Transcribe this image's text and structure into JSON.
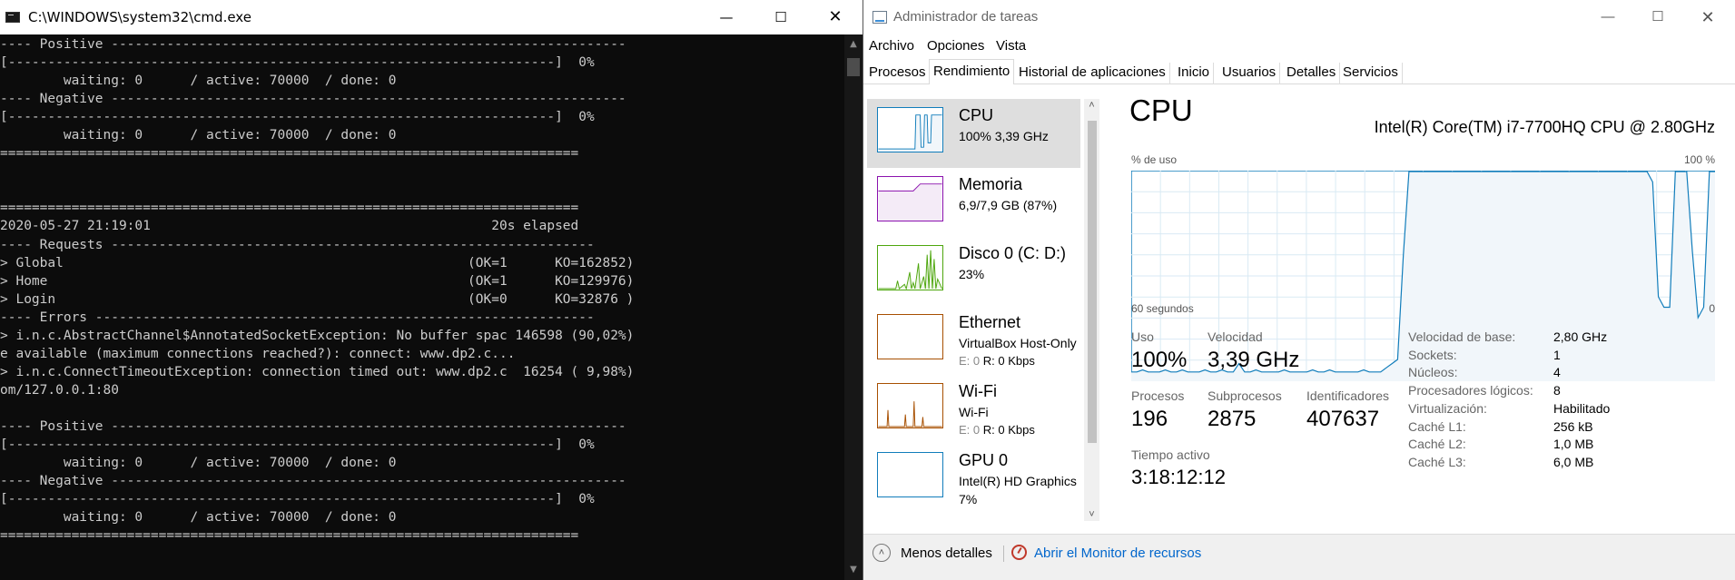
{
  "cmd": {
    "title": "C:\\WINDOWS\\system32\\cmd.exe",
    "lines": [
      "---- Positive -----------------------------------------------------------------",
      "[---------------------------------------------------------------------]  0%",
      "        waiting: 0      / active: 70000  / done: 0",
      "---- Negative -----------------------------------------------------------------",
      "[---------------------------------------------------------------------]  0%",
      "        waiting: 0      / active: 70000  / done: 0",
      "=========================================================================",
      "",
      "",
      "=========================================================================",
      "2020-05-27 21:19:01                                           20s elapsed",
      "---- Requests -------------------------------------------------------------",
      "> Global                                                   (OK=1      KO=162852)",
      "> Home                                                     (OK=1      KO=129976)",
      "> Login                                                    (OK=0      KO=32876 )",
      "---- Errors ---------------------------------------------------------------",
      "> i.n.c.AbstractChannel$AnnotatedSocketException: No buffer spac 146598 (90,02%)",
      "e available (maximum connections reached?): connect: www.dp2.c...",
      "> i.n.c.ConnectTimeoutException: connection timed out: www.dp2.c  16254 ( 9,98%)",
      "om/127.0.0.1:80",
      "",
      "---- Positive -----------------------------------------------------------------",
      "[---------------------------------------------------------------------]  0%",
      "        waiting: 0      / active: 70000  / done: 0",
      "---- Negative -----------------------------------------------------------------",
      "[---------------------------------------------------------------------]  0%",
      "        waiting: 0      / active: 70000  / done: 0",
      "========================================================================="
    ]
  },
  "taskmgr": {
    "title": "Administrador de tareas",
    "menu": [
      "Archivo",
      "Opciones",
      "Vista"
    ],
    "tabs": [
      "Procesos",
      "Rendimiento",
      "Historial de aplicaciones",
      "Inicio",
      "Usuarios",
      "Detalles",
      "Servicios"
    ],
    "active_tab": "Rendimiento",
    "sidebar": [
      {
        "title": "CPU",
        "sub": "100%  3,39 GHz",
        "color": "#117dbb"
      },
      {
        "title": "Memoria",
        "sub": "6,9/7,9 GB (87%)",
        "color": "#8b12ae"
      },
      {
        "title": "Disco 0 (C: D:)",
        "sub": "23%",
        "color": "#4da60c"
      },
      {
        "title": "Ethernet",
        "sub": "VirtualBox Host-Only",
        "sub2_e": "E: 0",
        "sub2_r": "R: 0 Kbps",
        "color": "#a74f01"
      },
      {
        "title": "Wi-Fi",
        "sub": "Wi-Fi",
        "sub2_e": "E: 0",
        "sub2_r": "R: 0 Kbps",
        "color": "#a74f01"
      },
      {
        "title": "GPU 0",
        "sub": "Intel(R) HD Graphics",
        "sub2": "7%",
        "color": "#117dbb"
      }
    ],
    "main": {
      "title": "CPU",
      "cpu_name": "Intel(R) Core(TM) i7-7700HQ CPU @ 2.80GHz",
      "graph_top_left": "% de uso",
      "graph_top_right": "100 %",
      "graph_bottom_left": "60 segundos",
      "graph_bottom_right": "0",
      "stats": {
        "uso_label": "Uso",
        "uso": "100%",
        "velocidad_label": "Velocidad",
        "velocidad": "3,39 GHz",
        "procesos_label": "Procesos",
        "procesos": "196",
        "subprocesos_label": "Subprocesos",
        "subprocesos": "2875",
        "identificadores_label": "Identificadores",
        "identificadores": "407637",
        "tiempo_label": "Tiempo activo",
        "tiempo": "3:18:12:12"
      },
      "specs": [
        {
          "k": "Velocidad de base:",
          "v": "2,80 GHz"
        },
        {
          "k": "Sockets:",
          "v": "1"
        },
        {
          "k": "Núcleos:",
          "v": "4"
        },
        {
          "k": "Procesadores lógicos:",
          "v": "8"
        },
        {
          "k": "Virtualización:",
          "v": "Habilitado"
        },
        {
          "k": "Caché L1:",
          "v": "256 kB"
        },
        {
          "k": "Caché L2:",
          "v": "1,0 MB"
        },
        {
          "k": "Caché L3:",
          "v": "6,0 MB"
        }
      ]
    },
    "cpu_history_percent": [
      4,
      4,
      5,
      4,
      4,
      4,
      5,
      4,
      4,
      5,
      4,
      4,
      4,
      5,
      4,
      4,
      5,
      4,
      4,
      8,
      4,
      4,
      5,
      4,
      4,
      4,
      4,
      5,
      4,
      4,
      4,
      4,
      5,
      4,
      4,
      5,
      4,
      4,
      4,
      4,
      4,
      5,
      4,
      4,
      4,
      6,
      8,
      10,
      60,
      100,
      100,
      100,
      100,
      100,
      100,
      100,
      100,
      100,
      100,
      100,
      100,
      100,
      100,
      100,
      100,
      100,
      100,
      100,
      100,
      100,
      100,
      100,
      100,
      100,
      100,
      100,
      100,
      100,
      100,
      100,
      100,
      100,
      100,
      100,
      100,
      100,
      100,
      100,
      100,
      100,
      100,
      100,
      95,
      40,
      35,
      35,
      100,
      100,
      100,
      62,
      30,
      35,
      100,
      100
    ],
    "footer": {
      "fewer": "Menos detalles",
      "monitor": "Abrir el Monitor de recursos"
    }
  }
}
